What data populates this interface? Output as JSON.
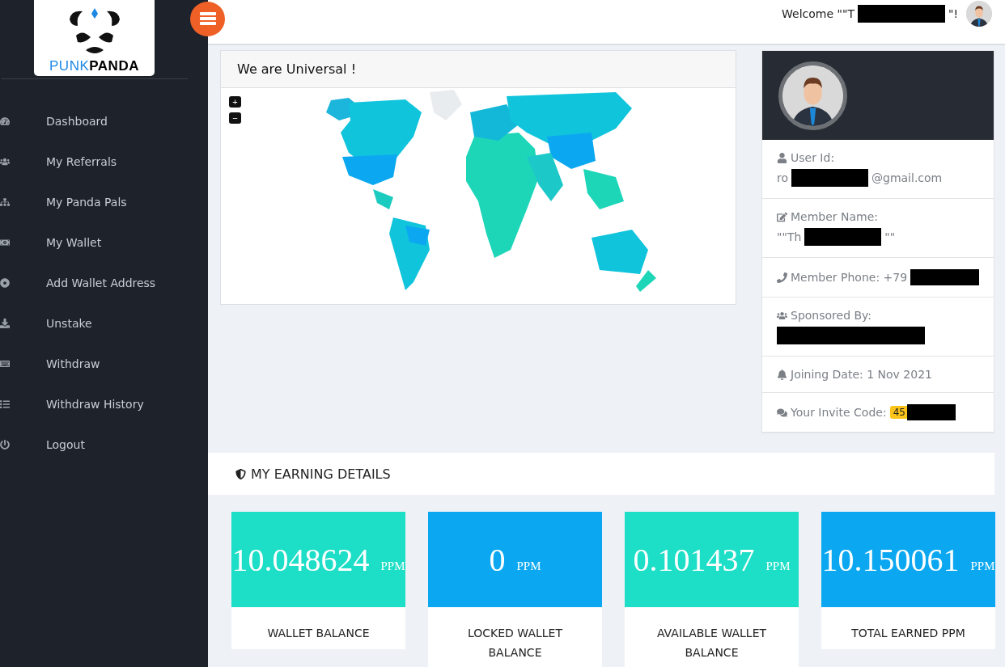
{
  "logo": {
    "first": "PUNK",
    "second": "PANDA"
  },
  "sidebar": {
    "items": [
      {
        "label": "Dashboard"
      },
      {
        "label": "My Referrals"
      },
      {
        "label": "My Panda Pals"
      },
      {
        "label": "My Wallet"
      },
      {
        "label": "Add Wallet Address"
      },
      {
        "label": "Unstake"
      },
      {
        "label": "Withdraw"
      },
      {
        "label": "Withdraw History"
      },
      {
        "label": "Logout"
      }
    ]
  },
  "header": {
    "welcome_start": "Welcome \"\"T",
    "welcome_end": "\"!"
  },
  "map_card": {
    "title": "We are Universal !",
    "zoom_in": "+",
    "zoom_out": "−"
  },
  "profile": {
    "rows": [
      {
        "label": "User Id:",
        "value_start": "ro",
        "value_end": "@gmail.com",
        "kind": "stacked"
      },
      {
        "label": "Member Name:",
        "value_start": "\"\"Th",
        "value_end": "\"\"",
        "kind": "stacked"
      },
      {
        "label": "Member Phone: +79",
        "kind": "inline"
      },
      {
        "label": "Sponsored By:",
        "kind": "stacked"
      },
      {
        "label": "Joining Date: 1 Nov 2021",
        "kind": "plain"
      },
      {
        "label": "Your Invite Code:",
        "badge": "45",
        "kind": "badge"
      }
    ]
  },
  "earnings": {
    "title": "MY EARNING DETAILS",
    "cards": [
      {
        "value": "10.048624",
        "unit": "PPM",
        "label": "WALLET BALANCE",
        "color": "#1ddec6"
      },
      {
        "value": "0",
        "unit": "PPM",
        "label": "LOCKED WALLET BALANCE",
        "color": "#0ba8f1"
      },
      {
        "value": "0.101437",
        "unit": "PPM",
        "label": "AVAILABLE WALLET BALANCE",
        "color": "#1ddec6"
      },
      {
        "value": "10.150061",
        "unit": "PPM",
        "label": "TOTAL EARNED PPM",
        "color": "#0ba8f1"
      }
    ]
  }
}
